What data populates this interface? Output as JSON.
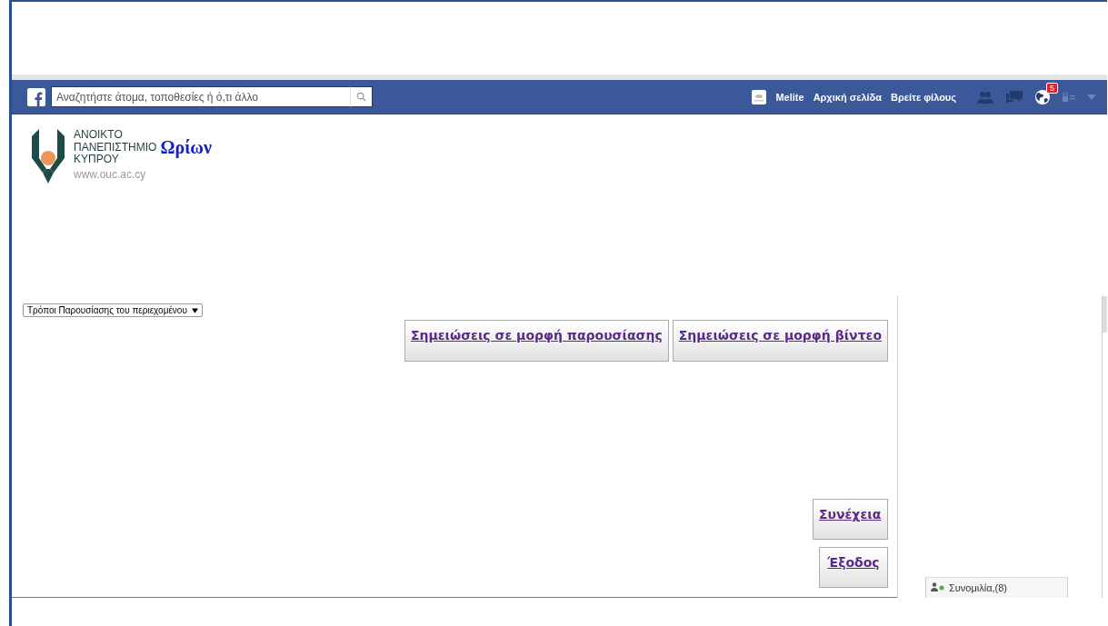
{
  "topbar": {
    "search": {
      "placeholder": "Αναζητήστε άτομα, τοποθεσίες ή ό,τι άλλο"
    },
    "nav": [
      {
        "kind": "profile",
        "label": "Melite"
      },
      {
        "kind": "link",
        "label": "Αρχική σελίδα"
      },
      {
        "kind": "link",
        "label": "Βρείτε φίλους"
      }
    ],
    "notifications": {
      "badge": "5"
    }
  },
  "logo": {
    "lines": [
      "ΑΝΟΙΚΤΟ",
      "ΠΑΝΕΠΙΣΤΗΜΙΟ",
      "ΚΥΠΡΟΥ"
    ],
    "url": "www.ouc.ac.cy",
    "name": "Ωρίων"
  },
  "view_select": {
    "value": "Τρόποι Παρουσίασης του περιεχομένου"
  },
  "note_buttons": [
    "Σημειώσεις σε μορφή παρουσίασης",
    "Σημειώσεις σε μορφή βίντεο"
  ],
  "nav_buttons": [
    {
      "kind": "continue",
      "label": "Συνέχεια"
    },
    {
      "kind": "exit",
      "label": "Έξοδος"
    }
  ],
  "chat": {
    "label": "Συνομιλία,(8)"
  }
}
